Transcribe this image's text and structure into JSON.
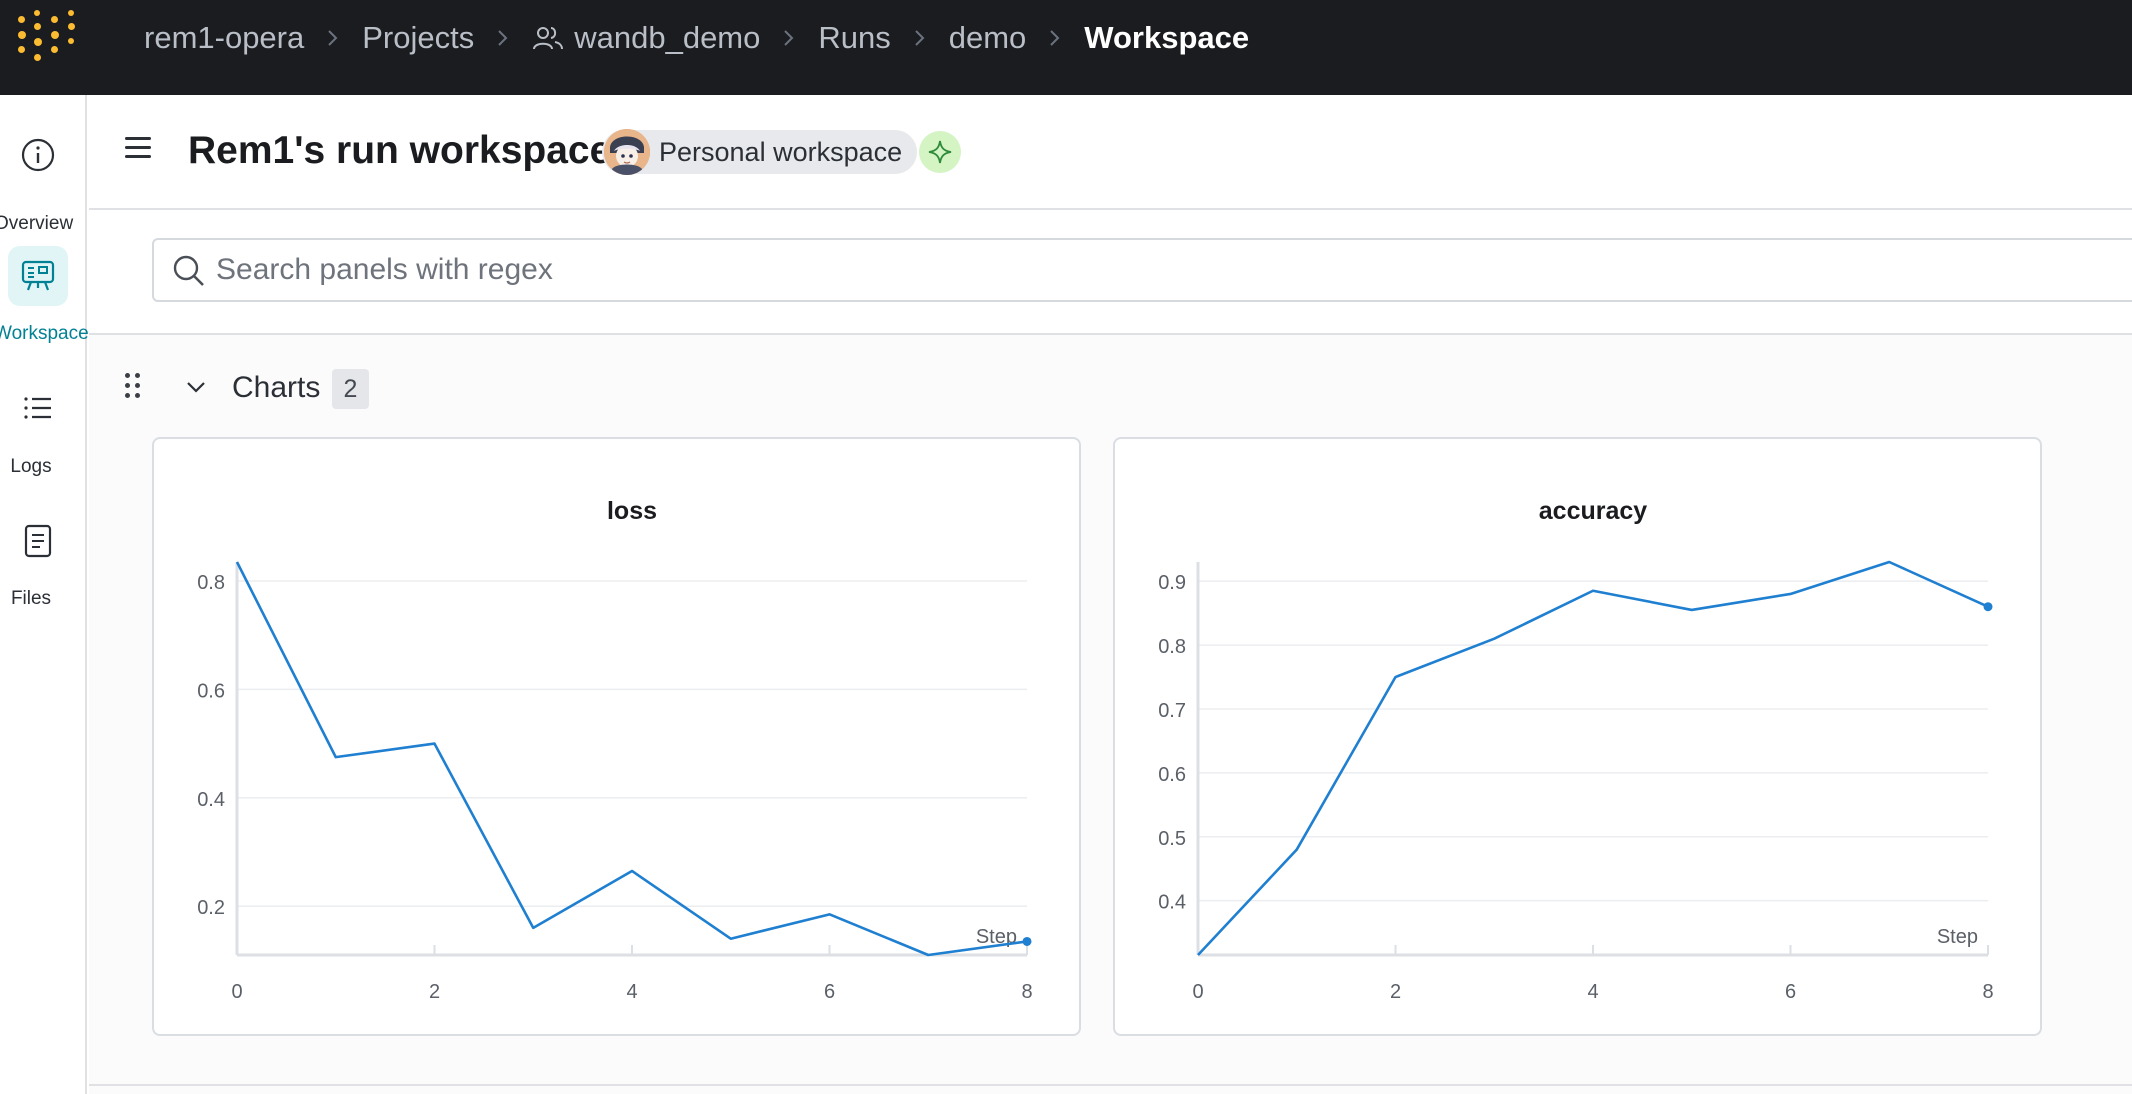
{
  "breadcrumb": {
    "items": [
      "rem1-opera",
      "Projects",
      "wandb_demo",
      "Runs",
      "demo"
    ],
    "current": "Workspace"
  },
  "nav": {
    "overview": "Overview",
    "workspace": "Workspace",
    "logs": "Logs",
    "files": "Files"
  },
  "header": {
    "title": "Rem1's run workspace",
    "workspace_label": "Personal workspace"
  },
  "search": {
    "placeholder": "Search panels with regex"
  },
  "section": {
    "title": "Charts",
    "count": "2"
  },
  "colors": {
    "line": "#1f7fd0",
    "accent": "#038194",
    "logo": "#fcbc32",
    "topbar": "#1a1c1f"
  },
  "chart_data": [
    {
      "type": "line",
      "title": "loss",
      "xlabel": "Step",
      "ylabel": "",
      "x": [
        0,
        1,
        2,
        3,
        4,
        5,
        6,
        7,
        8
      ],
      "series": [
        {
          "values": [
            0.835,
            0.475,
            0.5,
            0.16,
            0.265,
            0.14,
            0.185,
            0.11,
            0.135
          ]
        }
      ],
      "xlim": [
        0,
        8
      ],
      "ylim": [
        0.11,
        0.835
      ],
      "yticks": [
        0.2,
        0.4,
        0.6,
        0.8
      ],
      "xticks": [
        0,
        2,
        4,
        6,
        8
      ],
      "grid": true
    },
    {
      "type": "line",
      "title": "accuracy",
      "xlabel": "Step",
      "ylabel": "",
      "x": [
        0,
        1,
        2,
        3,
        4,
        5,
        6,
        7,
        8
      ],
      "series": [
        {
          "values": [
            0.315,
            0.48,
            0.75,
            0.81,
            0.885,
            0.855,
            0.88,
            0.93,
            0.86
          ]
        }
      ],
      "xlim": [
        0,
        8
      ],
      "ylim": [
        0.315,
        0.93
      ],
      "yticks": [
        0.4,
        0.5,
        0.6,
        0.7,
        0.8,
        0.9
      ],
      "xticks": [
        0,
        2,
        4,
        6,
        8
      ],
      "grid": true
    }
  ]
}
